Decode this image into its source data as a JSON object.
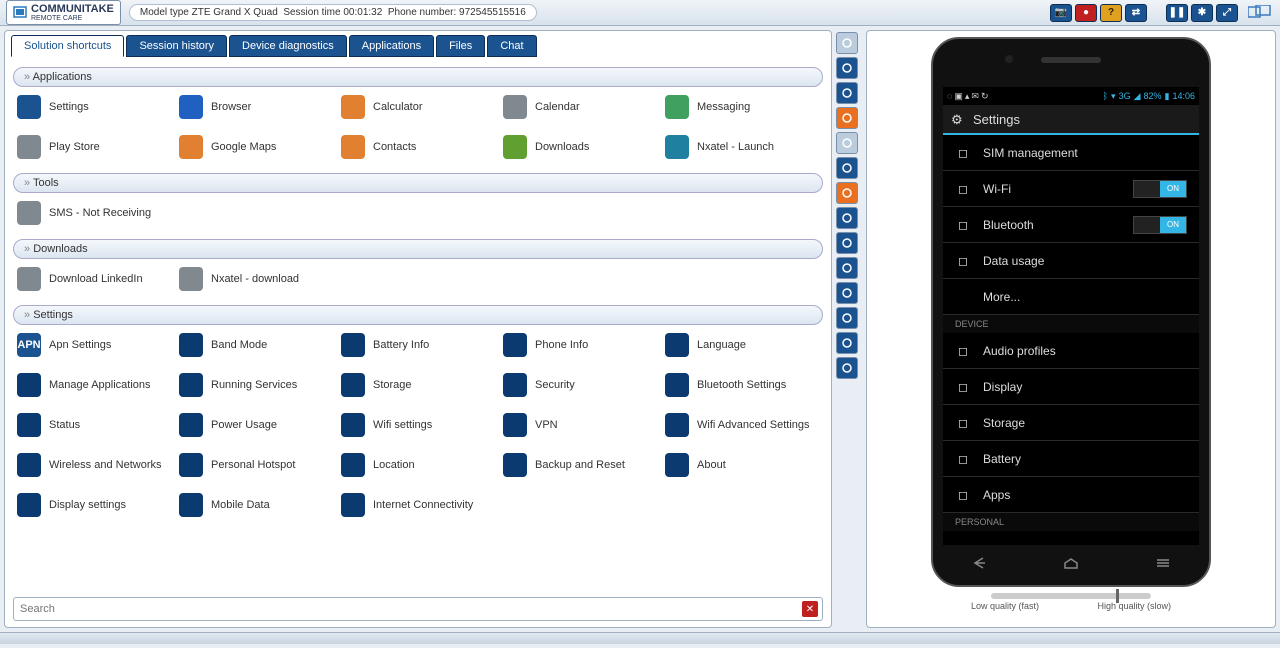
{
  "brand": {
    "name": "COMMUNITAKE",
    "sub": "REMOTE CARE"
  },
  "session": {
    "model_label": "Model type",
    "model": "ZTE Grand X Quad",
    "time_label": "Session time",
    "time": "00:01:32",
    "phone_label": "Phone number:",
    "phone": "972545515516"
  },
  "toolbar_top": [
    {
      "name": "camera-icon",
      "glyph": "📷"
    },
    {
      "name": "record-icon",
      "glyph": "●",
      "cls": "red"
    },
    {
      "name": "help-icon",
      "glyph": "?",
      "cls": "yellow"
    },
    {
      "name": "transfer-icon",
      "glyph": "⇄"
    },
    {
      "name": "gap"
    },
    {
      "name": "pause-icon",
      "glyph": "❚❚"
    },
    {
      "name": "snowflake-icon",
      "glyph": "✱"
    },
    {
      "name": "expand-icon",
      "glyph": "⤢"
    }
  ],
  "tabs": [
    {
      "label": "Solution shortcuts",
      "active": true
    },
    {
      "label": "Session history"
    },
    {
      "label": "Device diagnostics"
    },
    {
      "label": "Applications"
    },
    {
      "label": "Files"
    },
    {
      "label": "Chat"
    }
  ],
  "sections": [
    {
      "title": "Applications",
      "items": [
        {
          "label": "Settings",
          "icon": "gear-icon",
          "cls": "c-blue"
        },
        {
          "label": "Browser",
          "icon": "globe-icon",
          "cls": "c-globe"
        },
        {
          "label": "Calculator",
          "icon": "calculator-icon",
          "cls": "c-orange"
        },
        {
          "label": "Calendar",
          "icon": "calendar-icon",
          "cls": "c-gray"
        },
        {
          "label": "Messaging",
          "icon": "message-icon",
          "cls": "c-green"
        },
        {
          "label": "Play Store",
          "icon": "play-icon",
          "cls": "c-gray"
        },
        {
          "label": "Google Maps",
          "icon": "map-icon",
          "cls": "c-orange"
        },
        {
          "label": "Contacts",
          "icon": "contacts-icon",
          "cls": "c-orange"
        },
        {
          "label": "Downloads",
          "icon": "download-icon",
          "cls": "c-dl"
        },
        {
          "label": "Nxatel - Launch",
          "icon": "launch-icon",
          "cls": "c-teal"
        }
      ]
    },
    {
      "title": "Tools",
      "items": [
        {
          "label": "SMS - Not Receiving",
          "icon": "sms-icon",
          "cls": "c-gray"
        }
      ]
    },
    {
      "title": "Downloads",
      "items": [
        {
          "label": "Download LinkedIn",
          "icon": "download-icon",
          "cls": "c-gray"
        },
        {
          "label": "Nxatel - download",
          "icon": "download-icon",
          "cls": "c-gray"
        }
      ]
    },
    {
      "title": "Settings",
      "items": [
        {
          "label": "Apn Settings",
          "icon": "apn-icon",
          "cls": "c-apn",
          "txt": "APN"
        },
        {
          "label": "Band Mode",
          "icon": "band-icon",
          "cls": "c-navy"
        },
        {
          "label": "Battery Info",
          "icon": "battery-icon",
          "cls": "c-navy"
        },
        {
          "label": "Phone Info",
          "icon": "info-icon",
          "cls": "c-navy"
        },
        {
          "label": "Language",
          "icon": "language-icon",
          "cls": "c-navy"
        },
        {
          "label": "Manage Applications",
          "icon": "apps-icon",
          "cls": "c-navy"
        },
        {
          "label": "Running Services",
          "icon": "services-icon",
          "cls": "c-navy"
        },
        {
          "label": "Storage",
          "icon": "storage-icon",
          "cls": "c-navy"
        },
        {
          "label": "Security",
          "icon": "security-icon",
          "cls": "c-navy"
        },
        {
          "label": "Bluetooth Settings",
          "icon": "bluetooth-icon",
          "cls": "c-navy"
        },
        {
          "label": "Status",
          "icon": "status-icon",
          "cls": "c-navy"
        },
        {
          "label": "Power Usage",
          "icon": "power-icon",
          "cls": "c-navy"
        },
        {
          "label": "Wifi settings",
          "icon": "wifi-icon",
          "cls": "c-navy"
        },
        {
          "label": "VPN",
          "icon": "vpn-icon",
          "cls": "c-navy"
        },
        {
          "label": "Wifi Advanced Settings",
          "icon": "wifiadv-icon",
          "cls": "c-navy"
        },
        {
          "label": "Wireless and Networks",
          "icon": "wireless-icon",
          "cls": "c-navy"
        },
        {
          "label": "Personal Hotspot",
          "icon": "hotspot-icon",
          "cls": "c-navy"
        },
        {
          "label": "Location",
          "icon": "location-icon",
          "cls": "c-navy"
        },
        {
          "label": "Backup and Reset",
          "icon": "backup-icon",
          "cls": "c-navy"
        },
        {
          "label": "About",
          "icon": "about-icon",
          "cls": "c-navy"
        },
        {
          "label": "Display settings",
          "icon": "display-icon",
          "cls": "c-navy"
        },
        {
          "label": "Mobile Data",
          "icon": "mobiledata-icon",
          "cls": "c-navy"
        },
        {
          "label": "Internet Connectivity",
          "icon": "internet-icon",
          "cls": "c-navy"
        }
      ]
    }
  ],
  "search": {
    "placeholder": "Search"
  },
  "sidetools": [
    {
      "name": "pointer-icon",
      "cls": ""
    },
    {
      "name": "wave-icon",
      "cls": "dark"
    },
    {
      "name": "circle-icon",
      "cls": "dark"
    },
    {
      "name": "line-icon",
      "cls": "orange"
    },
    {
      "name": "rect-icon",
      "cls": ""
    },
    {
      "name": "fillcircle-icon",
      "cls": "dark"
    },
    {
      "name": "target-icon",
      "cls": "orange"
    },
    {
      "name": "dotcircle-icon",
      "cls": "dark"
    },
    {
      "name": "network-icon",
      "cls": "dark"
    },
    {
      "name": "www-icon",
      "cls": "dark"
    },
    {
      "name": "text-icon",
      "cls": "dark"
    },
    {
      "name": "undo-icon",
      "cls": "dark"
    },
    {
      "name": "home-icon",
      "cls": "dark"
    },
    {
      "name": "list-icon",
      "cls": "dark"
    }
  ],
  "phone": {
    "status": {
      "time": "14:06",
      "battery": "82%",
      "net": "3G"
    },
    "title": "Settings",
    "rows": [
      {
        "label": "SIM management",
        "icon": "sim-icon"
      },
      {
        "label": "Wi-Fi",
        "icon": "wifi-icon",
        "toggle": "ON"
      },
      {
        "label": "Bluetooth",
        "icon": "bluetooth-icon",
        "toggle": "ON"
      },
      {
        "label": "Data usage",
        "icon": "data-icon"
      },
      {
        "label": "More...",
        "icon": ""
      }
    ],
    "hdr1": "DEVICE",
    "rows2": [
      {
        "label": "Audio profiles",
        "icon": "audio-icon"
      },
      {
        "label": "Display",
        "icon": "display-icon"
      },
      {
        "label": "Storage",
        "icon": "storage-icon"
      },
      {
        "label": "Battery",
        "icon": "battery-icon"
      },
      {
        "label": "Apps",
        "icon": "apps-icon"
      }
    ],
    "hdr2": "PERSONAL"
  },
  "quality": {
    "low": "Low quality (fast)",
    "high": "High quality (slow)"
  }
}
